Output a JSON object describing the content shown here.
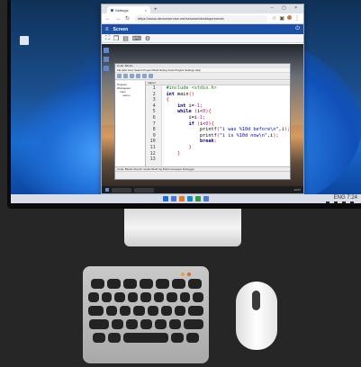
{
  "browser": {
    "tab_title": "Settings",
    "tab_close": "×",
    "new_tab": "+",
    "window_controls": "– ▢ ×",
    "url": "https://www.deviceservice.net/session/desktop/remote",
    "nav": {
      "back": "←",
      "forward": "→",
      "reload": "↻"
    }
  },
  "app": {
    "menu_icon": "≡",
    "brand": "Screen",
    "power_icon": "⏻"
  },
  "ide": {
    "title": "Code::Blocks",
    "menu": "File  Edit  View  Search  Project  Build  Debug  Tools  Plugins  Settings  Help",
    "tree_header": "Projects",
    "tree_items": [
      "Workspace",
      "main",
      "main.c"
    ],
    "editor_tab": "main.c",
    "line_numbers": [
      "1",
      "2",
      "3",
      "4",
      "5",
      "6",
      "7",
      "8",
      "9",
      "10",
      "11",
      "12",
      "13"
    ],
    "code_lines": [
      "#include <stdio.h>",
      "",
      "int main()",
      "{",
      "    int i=-1;",
      "    while (i<0){",
      "        i=i-1;",
      "        if (i<0){",
      "            printf(\"i was %10d before\\n\",i);",
      "            printf(\"i is %10d now\\n\",i);",
      "            break;",
      "        }",
      "    }"
    ],
    "status_tabs": "Code::Blocks  Search results  Build log  Build messages  Debugger"
  },
  "host_taskbar": {
    "tray_text": "ENG  7:24"
  },
  "remote_taskbar": {
    "tray_text": "12:07"
  },
  "colors": {
    "background": "#262626",
    "app_header": "#1c4fa6",
    "keyboard_led_1": "#e8a23a",
    "keyboard_led_2": "#d66b2f"
  }
}
